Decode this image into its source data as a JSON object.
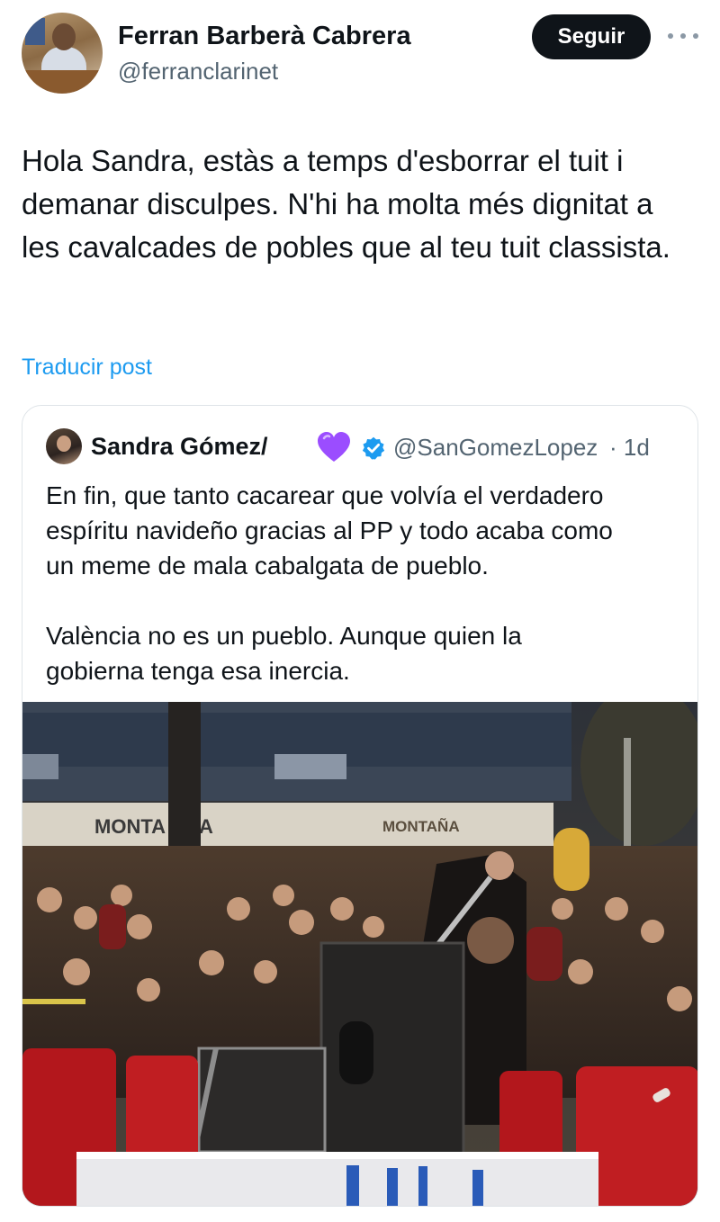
{
  "author": {
    "name": "Ferran Barberà Cabrera",
    "handle": "@ferranclarinet"
  },
  "follow_button": {
    "label": "Seguir"
  },
  "more_icon": "more-horizontal-icon",
  "post": {
    "text": "Hola Sandra, estàs a temps d'esborrar el tuit i demanar disculpes. N'hi ha molta més dignitat a les cavalcades de pobles que al teu tuit classista."
  },
  "translate_link": "Traducir post",
  "quoted": {
    "name": "Sandra Gómez/",
    "heart_icon": "purple-heart-icon",
    "verified_icon": "verified-badge-icon",
    "handle": "@SanGomezLopez",
    "time": "· 1d",
    "text": "En fin, que tanto cacarear que volvía el verdadero\nespíritu navideño gracias al PP y todo acaba como\nun meme de mala cabalgata de pueblo.\n\nValència no es un pueblo. Aunque quien la\ngobierna tenga esa inercia.",
    "media": {
      "sign_left": "MONTA",
      "sign_left_end": "A",
      "sign_right": "MONTAÑA"
    }
  },
  "colors": {
    "text": "#0f1419",
    "secondary": "#536471",
    "link": "#1d9bf0",
    "follow_bg": "#0f1419",
    "verified": "#1d9bf0",
    "heart": "#9b4dff"
  }
}
